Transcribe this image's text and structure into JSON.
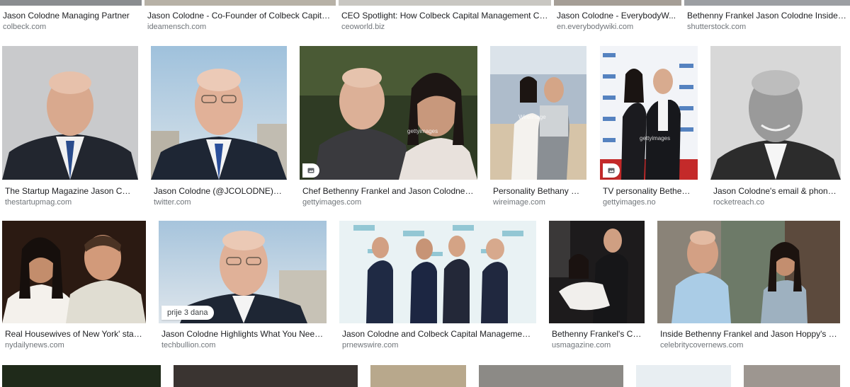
{
  "top_row": [
    {
      "caption": "Jason Colodne Managing Partner",
      "domain": "colbeck.com"
    },
    {
      "caption": "Jason Colodne - Co-Founder of Colbeck Capita...",
      "domain": "ideamensch.com"
    },
    {
      "caption": "CEO Spotlight: How Colbeck Capital Management Co...",
      "domain": "ceoworld.biz"
    },
    {
      "caption": "Jason Colodne - EverybodyW...",
      "domain": "en.everybodywiki.com"
    },
    {
      "caption": "Bethenny Frankel Jason Colodne Inside ...",
      "domain": "shutterstock.com"
    }
  ],
  "row2": [
    {
      "caption": "The Startup Magazine Jason Colo...",
      "domain": "thestartupmag.com"
    },
    {
      "caption": "Jason Colodne (@JCOLODNE) | T...",
      "domain": "twitter.com"
    },
    {
      "caption": "Chef Bethenny Frankel and Jason Colodne att...",
      "domain": "gettyimages.com",
      "watermark": "gettyimages"
    },
    {
      "caption": "Personality Bethany Fra...",
      "domain": "wireimage.com",
      "watermark": "WireImage"
    },
    {
      "caption": "TV personality Bethenn...",
      "domain": "gettyimages.no",
      "watermark": "gettyimages"
    },
    {
      "caption": "Jason Colodne's email & phone |...",
      "domain": "rocketreach.co"
    }
  ],
  "row3": [
    {
      "caption": "Real Housewives of New York' star B...",
      "domain": "nydailynews.com"
    },
    {
      "caption": "Jason Colodne Highlights What You Need t...",
      "domain": "techbullion.com",
      "badge": "prije 3 dana"
    },
    {
      "caption": "Jason Colodne and Colbeck Capital Management S...",
      "domain": "prnewswire.com"
    },
    {
      "caption": "Bethenny Frankel's Co...",
      "domain": "usmagazine.com"
    },
    {
      "caption": "Inside Bethenny Frankel and Jason Hoppy's tro...",
      "domain": "celebritycovernews.com"
    }
  ],
  "icons": {
    "product_badge": "image-icon"
  }
}
